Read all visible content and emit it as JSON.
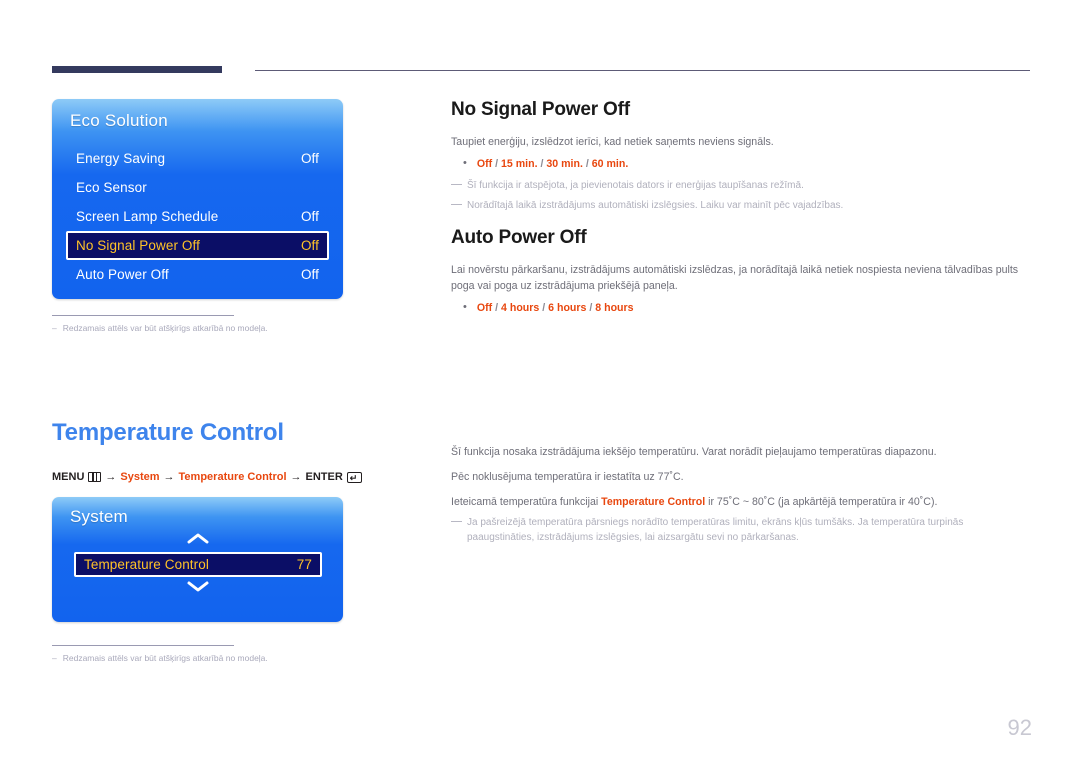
{
  "page": {
    "number": "92"
  },
  "figure_eco": {
    "title": "Eco Solution",
    "rows": [
      {
        "label": "Energy Saving",
        "value": "Off",
        "selected": false
      },
      {
        "label": "Eco Sensor",
        "value": "",
        "selected": false
      },
      {
        "label": "Screen Lamp Schedule",
        "value": "Off",
        "selected": false
      },
      {
        "label": "No Signal Power Off",
        "value": "Off",
        "selected": true
      },
      {
        "label": "Auto Power Off",
        "value": "Off",
        "selected": false
      }
    ],
    "note": "Redzamais attēls var būt atšķirīgs atkarībā no modeļa.",
    "note_dash": "–"
  },
  "figure_system": {
    "title": "System",
    "row": {
      "label": "Temperature Control",
      "value": "77"
    },
    "scroll_up_icon": "chevron-up-icon",
    "scroll_down_icon": "chevron-down-icon",
    "note": "Redzamais attēls var būt atšķirīgs atkarībā no modeļa.",
    "note_dash": "–"
  },
  "heading_temperature": {
    "title": "Temperature Control",
    "menu_path": {
      "menu_label": "MENU",
      "menu_icon": "menu-icon",
      "arrow": "→",
      "step1": "System",
      "step2": "Temperature Control",
      "enter_label": "ENTER",
      "enter_icon": "enter-key-icon",
      "enter_glyph": "↵"
    }
  },
  "sections": [
    {
      "id": "no-signal-power-off",
      "heading": "No Signal Power Off",
      "paragraphs": [
        "Taupiet enerģiju, izslēdzot ierīci, kad netiek saņemts neviens signāls."
      ],
      "bullet": {
        "dot": "•",
        "parts": [
          "Off",
          "15 min.",
          "30 min.",
          "60 min."
        ],
        "separator": "/"
      },
      "notes": [
        "Šī funkcija ir atspējota, ja pievienotais dators ir enerģijas taupīšanas režīmā.",
        "Norādītajā laikā izstrādājums automātiski izslēgsies. Laiku var mainīt pēc vajadzības."
      ]
    },
    {
      "id": "auto-power-off",
      "heading": "Auto Power Off",
      "paragraphs": [
        "Lai novērstu pārkaršanu, izstrādājums automātiski izslēdzas, ja norādītajā laikā netiek nospiesta neviena tālvadības pults poga vai poga uz izstrādājuma priekšējā paneļa."
      ],
      "bullet": {
        "dot": "•",
        "parts": [
          "Off",
          "4 hours",
          "6 hours",
          "8 hours"
        ],
        "separator": "/"
      },
      "notes": []
    }
  ],
  "temperature_body": {
    "paragraph1": "Šī funkcija nosaka izstrādājuma iekšējo temperatūru. Varat norādīt pieļaujamo temperatūras diapazonu.",
    "paragraph2": "Pēc noklusējuma temperatūra ir iestatīta uz 77˚C.",
    "paragraph3_pre": "Ieteicamā temperatūra funkcijai ",
    "paragraph3_bold": "Temperature Control",
    "paragraph3_post": " ir 75˚C ~ 80˚C (ja apkārtējā temperatūra ir 40˚C).",
    "note": "Ja pašreizējā temperatūra pārsniegs norādīto temperatūras limitu, ekrāns kļūs tumšāks. Ja temperatūra turpinās paaugstināties, izstrādājums izslēgsies, lai aizsargātu sevi no pārkaršanas."
  },
  "colors": {
    "accent_blue": "#3e84ec",
    "accent_red": "#e8470f",
    "osd_blue": "#1668ef",
    "osd_selected": "#0b0e66",
    "osd_selected_text": "#ffc328",
    "header_bar": "#343a5e"
  }
}
